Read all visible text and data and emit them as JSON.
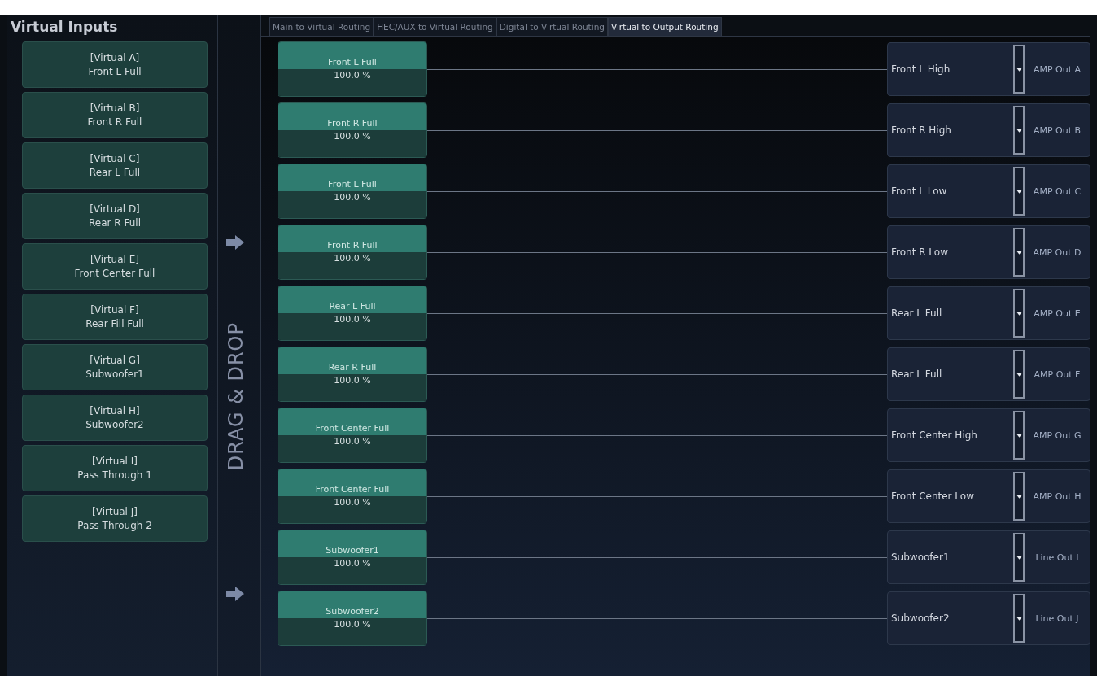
{
  "virtual_inputs": {
    "title": "Virtual Inputs",
    "items": [
      {
        "channel": "[Virtual A]",
        "name": "Front L Full"
      },
      {
        "channel": "[Virtual B]",
        "name": "Front R Full"
      },
      {
        "channel": "[Virtual C]",
        "name": "Rear L Full"
      },
      {
        "channel": "[Virtual D]",
        "name": "Rear R Full"
      },
      {
        "channel": "[Virtual E]",
        "name": "Front Center Full"
      },
      {
        "channel": "[Virtual F]",
        "name": "Rear Fill Full"
      },
      {
        "channel": "[Virtual G]",
        "name": "Subwoofer1"
      },
      {
        "channel": "[Virtual H]",
        "name": "Subwoofer2"
      },
      {
        "channel": "[Virtual I]",
        "name": "Pass Through 1"
      },
      {
        "channel": "[Virtual J]",
        "name": "Pass Through 2"
      }
    ]
  },
  "drag_hint": "DRAG & DROP",
  "tabs": [
    {
      "label": "Main to Virtual Routing",
      "selected": false
    },
    {
      "label": "HEC/AUX to Virtual Routing",
      "selected": false
    },
    {
      "label": "Digital to Virtual Routing",
      "selected": false
    },
    {
      "label": "Virtual to Output Routing",
      "selected": true
    }
  ],
  "routes": [
    {
      "source": "Front L Full",
      "gain": "100.0 %",
      "assignment": "Front L High",
      "output": "AMP Out A"
    },
    {
      "source": "Front R Full",
      "gain": "100.0 %",
      "assignment": "Front R High",
      "output": "AMP Out B"
    },
    {
      "source": "Front L Full",
      "gain": "100.0 %",
      "assignment": "Front L Low",
      "output": "AMP Out C"
    },
    {
      "source": "Front R Full",
      "gain": "100.0 %",
      "assignment": "Front R Low",
      "output": "AMP Out D"
    },
    {
      "source": "Rear L Full",
      "gain": "100.0 %",
      "assignment": "Rear L Full",
      "output": "AMP Out E"
    },
    {
      "source": "Rear R Full",
      "gain": "100.0 %",
      "assignment": "Rear L Full",
      "output": "AMP Out F"
    },
    {
      "source": "Front Center Full",
      "gain": "100.0 %",
      "assignment": "Front Center High",
      "output": "AMP Out G"
    },
    {
      "source": "Front Center Full",
      "gain": "100.0 %",
      "assignment": "Front Center Low",
      "output": "AMP Out H"
    },
    {
      "source": "Subwoofer1",
      "gain": "100.0 %",
      "assignment": "Subwoofer1",
      "output": "Line Out I"
    },
    {
      "source": "Subwoofer2",
      "gain": "100.0 %",
      "assignment": "Subwoofer2",
      "output": "Line Out J"
    }
  ]
}
